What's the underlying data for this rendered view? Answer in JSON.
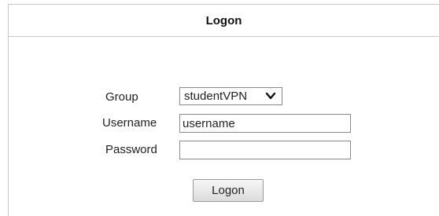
{
  "header": {
    "title": "Logon"
  },
  "form": {
    "group_label": "Group",
    "group_selected": "studentVPN",
    "username_label": "Username",
    "username_value": "username",
    "password_label": "Password",
    "password_value": ""
  },
  "actions": {
    "logon_label": "Logon"
  }
}
